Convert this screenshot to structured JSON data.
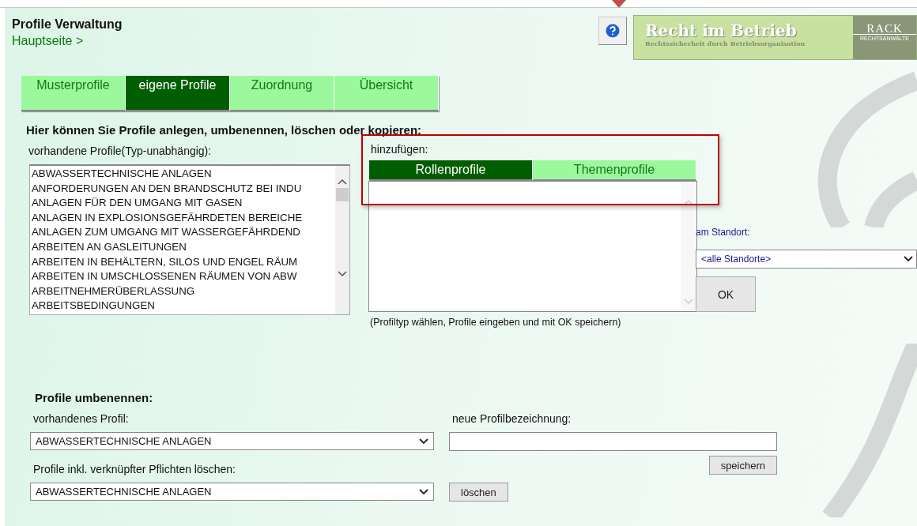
{
  "header": {
    "title": "Profile Verwaltung",
    "breadcrumb": "Hauptseite >"
  },
  "logo": {
    "title": "Recht im Betrieb",
    "subtitle": "Rechtssicherheit durch Betriebsorganisation",
    "brand": "RACK",
    "brand_sub": "RECHTSANWÄLTE"
  },
  "tabs": [
    {
      "label": "Musterprofile",
      "selected": false
    },
    {
      "label": "eigene Profile",
      "selected": true
    },
    {
      "label": "Zuordnung",
      "selected": false
    },
    {
      "label": "Übersicht",
      "selected": false
    }
  ],
  "intro": "Hier können Sie Profile anlegen, umbenennen, löschen oder kopieren:",
  "existing": {
    "label": "vorhandene Profile(Typ-unabhängig):",
    "items": [
      "ABWASSERTECHNISCHE ANLAGEN",
      "ANFORDERUNGEN AN DEN BRANDSCHUTZ BEI INDU",
      "ANLAGEN FÜR DEN UMGANG MIT GASEN",
      "ANLAGEN IN EXPLOSIONSGEFÄHRDETEN BEREICHE",
      "ANLAGEN ZUM UMGANG MIT WASSERGEFÄHRDEND",
      "ARBEITEN AN GASLEITUNGEN",
      "ARBEITEN IN BEHÄLTERN, SILOS UND ENGEL RÄUM",
      "ARBEITEN IN UMSCHLOSSENEN RÄUMEN VON ABW",
      "ARBEITNEHMERÜBERLASSUNG",
      "ARBEITSBEDINGUNGEN"
    ]
  },
  "add": {
    "label": "hinzufügen:",
    "types": [
      {
        "label": "Rollenprofile",
        "selected": true
      },
      {
        "label": "Themenprofile",
        "selected": false
      }
    ],
    "hint": "(Profiltyp wählen, Profile eingeben und mit OK speichern)",
    "highlighted": true
  },
  "location": {
    "label": "am Standort:",
    "value": "<alle Standorte>",
    "button": "OK"
  },
  "rename": {
    "heading": "Profile umbenennen:",
    "existing_label": "vorhandenes Profil:",
    "existing_value": "ABWASSERTECHNISCHE ANLAGEN",
    "new_label": "neue Profilbezeichnung:",
    "save": "speichern"
  },
  "delete": {
    "label": "Profile inkl. verknüpfter Pflichten löschen:",
    "value": "ABWASSERTECHNISCHE ANLAGEN",
    "button": "löschen"
  }
}
